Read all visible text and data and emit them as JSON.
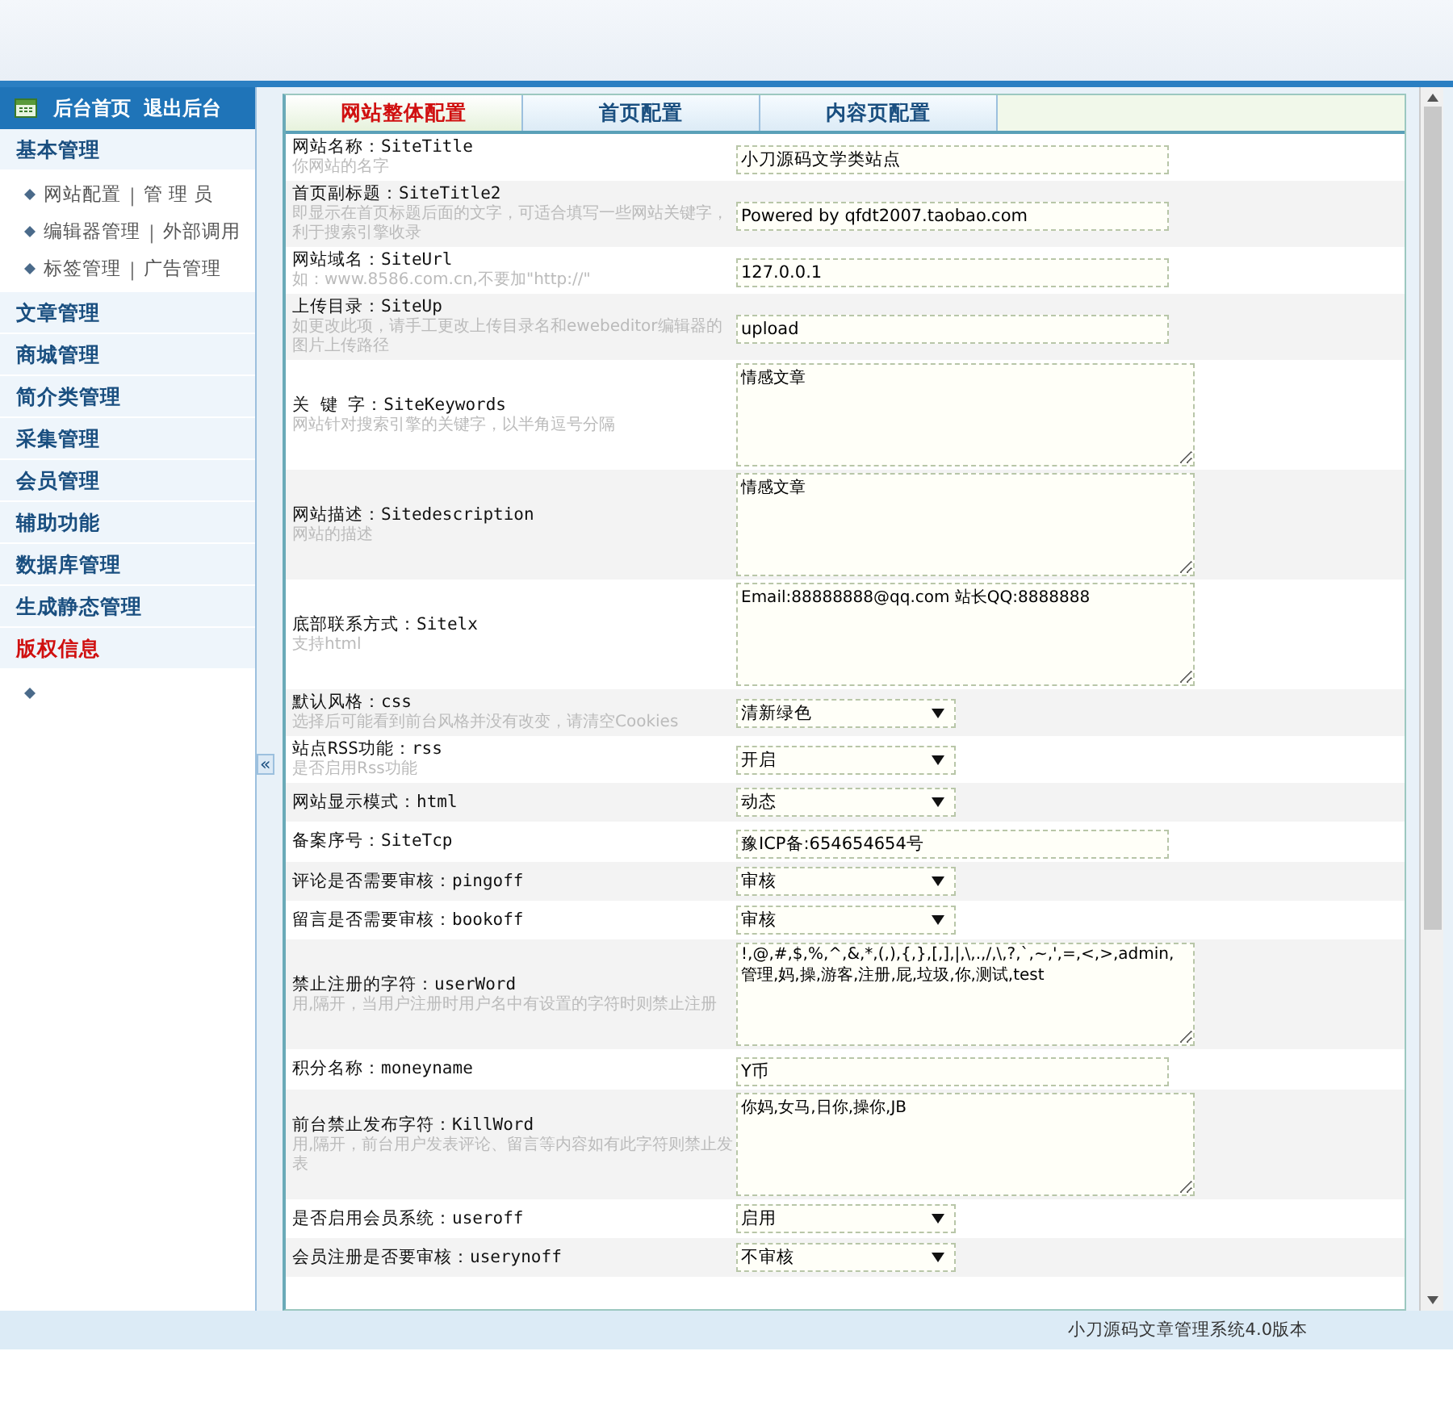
{
  "header": {
    "links": [
      "后台首页",
      "退出后台"
    ]
  },
  "sidebar": {
    "groups": [
      {
        "title": "基本管理",
        "expanded": true,
        "selected": false,
        "items": [
          {
            "links": [
              "网站配置",
              "管 理 员"
            ],
            "separator": "|"
          },
          {
            "links": [
              "编辑器管理",
              "外部调用"
            ],
            "separator": "|"
          },
          {
            "links": [
              "标签管理",
              "广告管理"
            ],
            "separator": "|"
          }
        ]
      },
      {
        "title": "文章管理",
        "expanded": false,
        "selected": false
      },
      {
        "title": "商城管理",
        "expanded": false,
        "selected": false
      },
      {
        "title": "简介类管理",
        "expanded": false,
        "selected": false
      },
      {
        "title": "采集管理",
        "expanded": false,
        "selected": false
      },
      {
        "title": "会员管理",
        "expanded": false,
        "selected": false
      },
      {
        "title": "辅助功能",
        "expanded": false,
        "selected": false
      },
      {
        "title": "数据库管理",
        "expanded": false,
        "selected": false
      },
      {
        "title": "生成静态管理",
        "expanded": false,
        "selected": false
      },
      {
        "title": "版权信息",
        "expanded": true,
        "selected": true
      }
    ]
  },
  "collapse_toggle": "«",
  "tabs": [
    {
      "label": "网站整体配置",
      "selected": true
    },
    {
      "label": "首页配置",
      "selected": false
    },
    {
      "label": "内容页配置",
      "selected": false
    }
  ],
  "settings": [
    {
      "kind": "text",
      "label": "网站名称：SiteTitle",
      "hint": "你网站的名字",
      "value": "小刀源码文学类站点"
    },
    {
      "kind": "text",
      "label": "首页副标题：SiteTitle2",
      "hint": "即显示在首页标题后面的文字，可适合填写一些网站关键字，利于搜索引擎收录",
      "value": "Powered by qfdt2007.taobao.com"
    },
    {
      "kind": "text",
      "label": "网站域名：SiteUrl",
      "hint": "如：www.8586.com.cn,不要加\"http://\"",
      "value": "127.0.0.1"
    },
    {
      "kind": "text",
      "label": "上传目录：SiteUp",
      "hint": "如更改此项，请手工更改上传目录名和ewebeditor编辑器的图片上传路径",
      "value": "upload"
    },
    {
      "kind": "textarea",
      "label": "关 键 字：SiteKeywords",
      "hint": "网站针对搜索引擎的关键字，以半角逗号分隔",
      "value": "情感文章"
    },
    {
      "kind": "textarea",
      "label": "网站描述：Sitedescription",
      "hint": "网站的描述",
      "value": "情感文章"
    },
    {
      "kind": "textarea",
      "label": "底部联系方式：Sitelx",
      "hint": "支持html",
      "value": "Email:88888888@qq.com 站长QQ:8888888"
    },
    {
      "kind": "select",
      "label": "默认风格：css",
      "hint": "选择后可能看到前台风格并没有改变，请清空Cookies",
      "value": "清新绿色"
    },
    {
      "kind": "select",
      "label": "站点RSS功能：rss",
      "hint": "是否启用Rss功能",
      "value": "开启"
    },
    {
      "kind": "select",
      "label": "网站显示模式：html",
      "value": "动态"
    },
    {
      "kind": "text",
      "label": "备案序号：SiteTcp",
      "value": "豫ICP备:654654654号"
    },
    {
      "kind": "select",
      "label": "评论是否需要审核：pingoff",
      "value": "审核"
    },
    {
      "kind": "select",
      "label": "留言是否需要审核：bookoff",
      "value": "审核"
    },
    {
      "kind": "textarea",
      "label": "禁止注册的字符：userWord",
      "hint": "用,隔开，当用户注册时用户名中有设置的字符时则禁止注册",
      "value": "!,@,#,$,%,^,&,*,(,),{,},[,],|,\\,.,/,\\,?,`,~,',=,<,>,admin,管理,妈,操,游客,注册,屁,垃圾,你,测试,test"
    },
    {
      "kind": "text",
      "label": "积分名称：moneyname",
      "value": "Y币"
    },
    {
      "kind": "textarea",
      "label": "前台禁止发布字符：KillWord",
      "hint": "用,隔开，前台用户发表评论、留言等内容如有此字符则禁止发表",
      "value": "你妈,女马,日你,操你,JB"
    },
    {
      "kind": "select",
      "label": "是否启用会员系统：useroff",
      "value": "启用"
    },
    {
      "kind": "select",
      "label": "会员注册是否要审核：userynoff",
      "value": "不审核"
    }
  ],
  "footer": "小刀源码文章管理系统4.0版本"
}
